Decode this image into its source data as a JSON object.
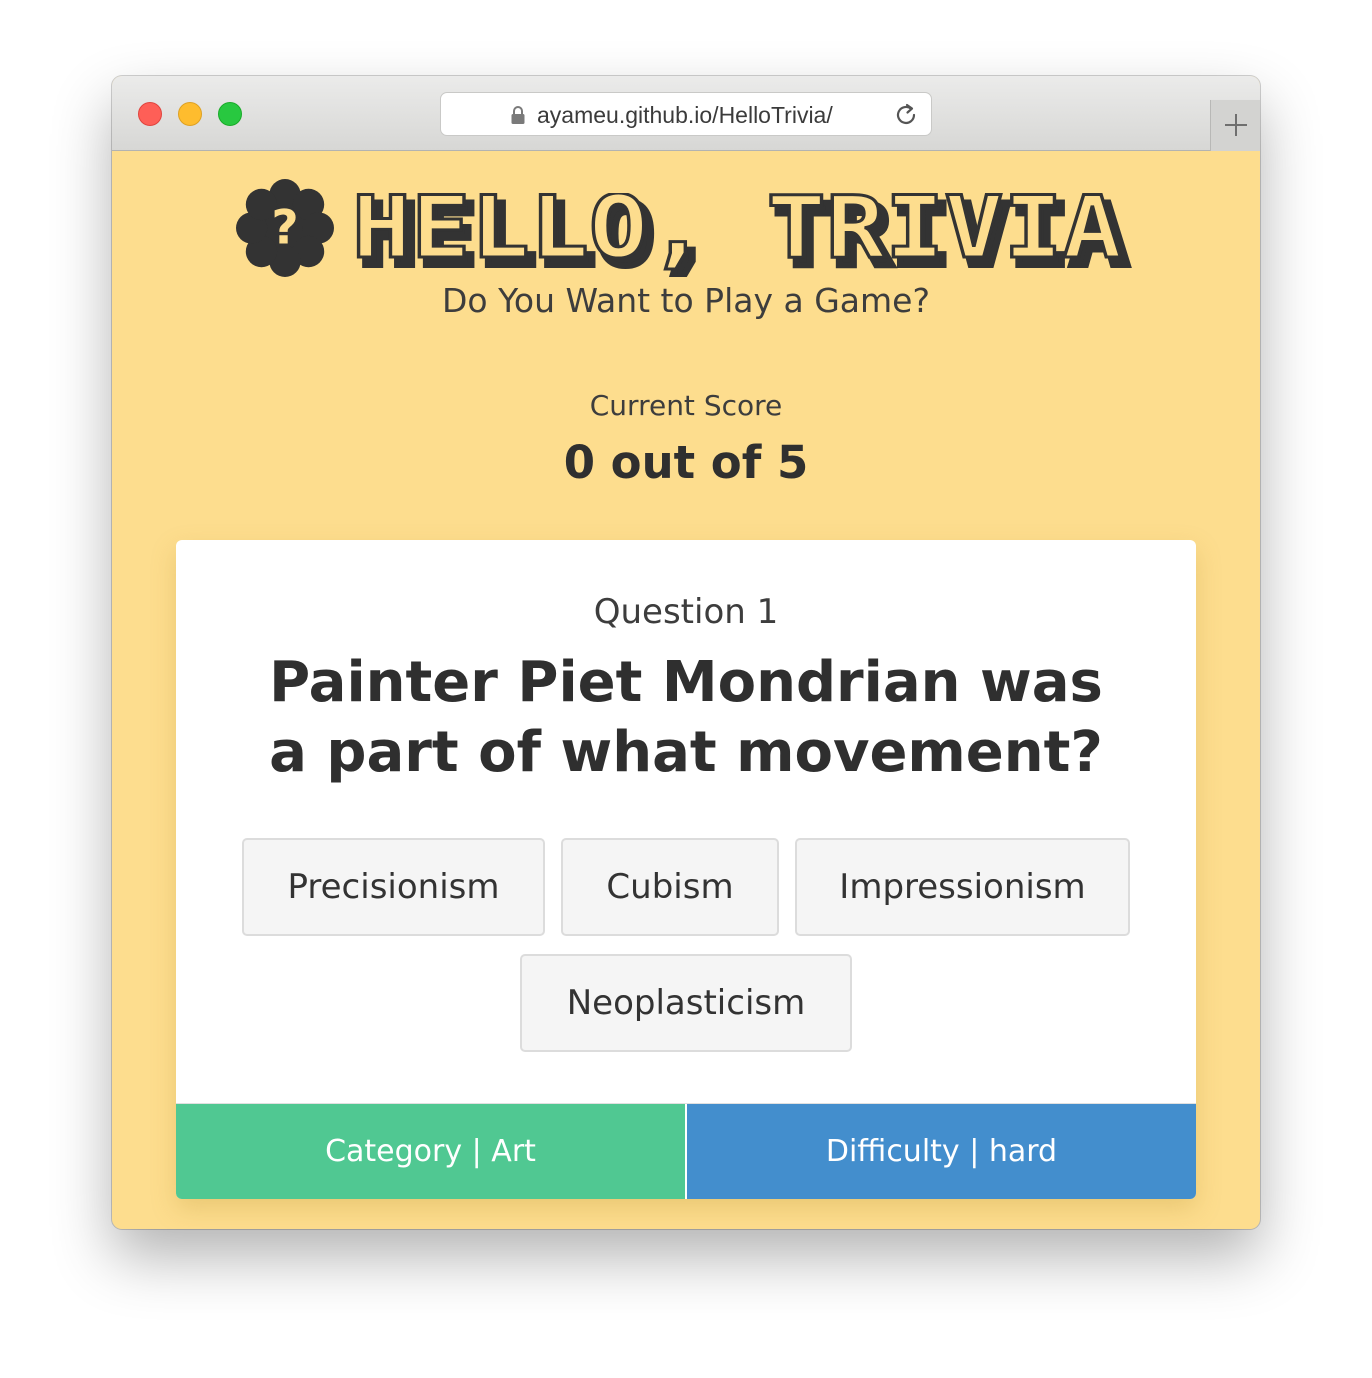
{
  "browser": {
    "url": "ayameu.github.io/HelloTrivia/"
  },
  "header": {
    "logo_text": "HELLO, TRIVIA",
    "badge_glyph": "?",
    "subtitle": "Do You Want to Play a Game?"
  },
  "score": {
    "label": "Current Score",
    "value": "0 out of 5"
  },
  "question": {
    "label": "Question 1",
    "text": "Painter Piet Mondrian was a part of what movement?",
    "answers": [
      "Precisionism",
      "Cubism",
      "Impressionism",
      "Neoplasticism"
    ]
  },
  "footer": {
    "category": "Category | Art",
    "difficulty": "Difficulty | hard"
  },
  "colors": {
    "page_background": "#fddd8e",
    "category_bg": "#50c892",
    "difficulty_bg": "#438ecd",
    "logo_dark": "#333333",
    "logo_fill": "#fddd8e"
  },
  "icons": [
    "lock-icon",
    "reload-icon",
    "plus-icon",
    "question-badge-icon"
  ]
}
